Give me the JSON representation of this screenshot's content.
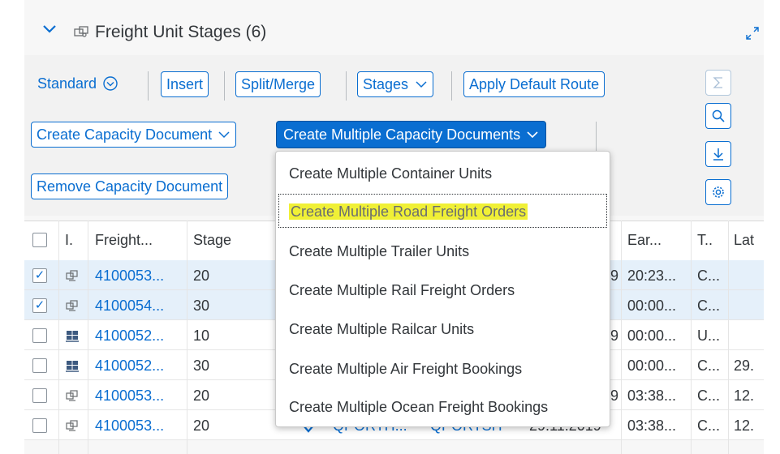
{
  "header": {
    "title": "Freight Unit Stages (6)",
    "collapse_icon": "chevron-down-icon",
    "section_icon": "freight-unit-icon",
    "fullscreen_icon": "fullscreen-icon"
  },
  "toolbar": {
    "variant_label": "Standard",
    "insert_label": "Insert",
    "split_merge_label": "Split/Merge",
    "stages_label": "Stages",
    "apply_default_route_label": "Apply Default Route",
    "create_capacity_document_label": "Create Capacity Document",
    "create_multiple_capacity_documents_label": "Create Multiple Capacity Documents",
    "remove_capacity_document_label": "Remove Capacity Document",
    "side_icons": [
      "sum-icon",
      "search-icon",
      "download-icon",
      "settings-icon"
    ]
  },
  "table": {
    "columns": [
      "I.",
      "Freight...",
      "Stage",
      "Ear...",
      "T..",
      "Lat"
    ],
    "rows": [
      {
        "selected": true,
        "icon": "freight-unit-icon",
        "freight": "4100053...",
        "stage": "20",
        "frag_date": "9",
        "ear": "20:23...",
        "t": "C...",
        "lat": ""
      },
      {
        "selected": true,
        "icon": "freight-unit-icon",
        "freight": "4100054...",
        "stage": "30",
        "frag_date": "",
        "ear": "00:00...",
        "t": "C...",
        "lat": ""
      },
      {
        "selected": false,
        "icon": "container-icon",
        "freight": "4100052...",
        "stage": "10",
        "frag_date": "9",
        "ear": "00:00...",
        "t": "U...",
        "lat": ""
      },
      {
        "selected": false,
        "icon": "container-icon",
        "freight": "4100052...",
        "stage": "30",
        "frag_date": "",
        "ear": "00:00...",
        "t": "C...",
        "lat": "29."
      },
      {
        "selected": false,
        "icon": "freight-unit-icon",
        "freight": "4100053...",
        "stage": "20",
        "frag_date": "9",
        "ear": "03:38...",
        "t": "C...",
        "lat": "12."
      },
      {
        "selected": false,
        "icon": "freight-unit-icon",
        "freight": "4100053...",
        "stage": "20",
        "frag_src": "QPORTH...",
        "frag_dst": "QPORTSH",
        "frag_date": "29.11.2019",
        "ear": "03:38...",
        "t": "C...",
        "lat": "12."
      }
    ]
  },
  "menu": {
    "items": [
      "Create Multiple Container Units",
      "Create Multiple Road Freight Orders",
      "Create Multiple Trailer Units",
      "Create Multiple Rail Freight Orders",
      "Create Multiple Railcar Units",
      "Create Multiple Air Freight Bookings",
      "Create Multiple Ocean Freight Bookings"
    ],
    "focused_index": 1,
    "highlight_color": "#f0f036"
  },
  "colors": {
    "accent": "#0a6ed1",
    "selected_row": "#e5f0fa"
  }
}
